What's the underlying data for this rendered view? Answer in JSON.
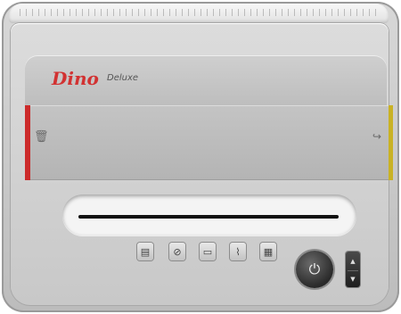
{
  "device": {
    "brand_name": "Dino",
    "model_name": "Deluxe"
  },
  "colors": {
    "brand_red": "#d23232",
    "left_indicator": "#cc2b2b",
    "right_indicator": "#c9b225"
  },
  "icons": {
    "bin_left": "trash-bin-icon",
    "bin_right": "recycle-arrow-icon",
    "function_buttons": [
      "card-feed-icon",
      "cd-shred-icon",
      "credit-card-icon",
      "paper-clip-icon",
      "keyboard-icon"
    ],
    "power": "power-icon",
    "rocker": [
      "forward-arrow-icon",
      "reverse-arrow-icon"
    ]
  }
}
